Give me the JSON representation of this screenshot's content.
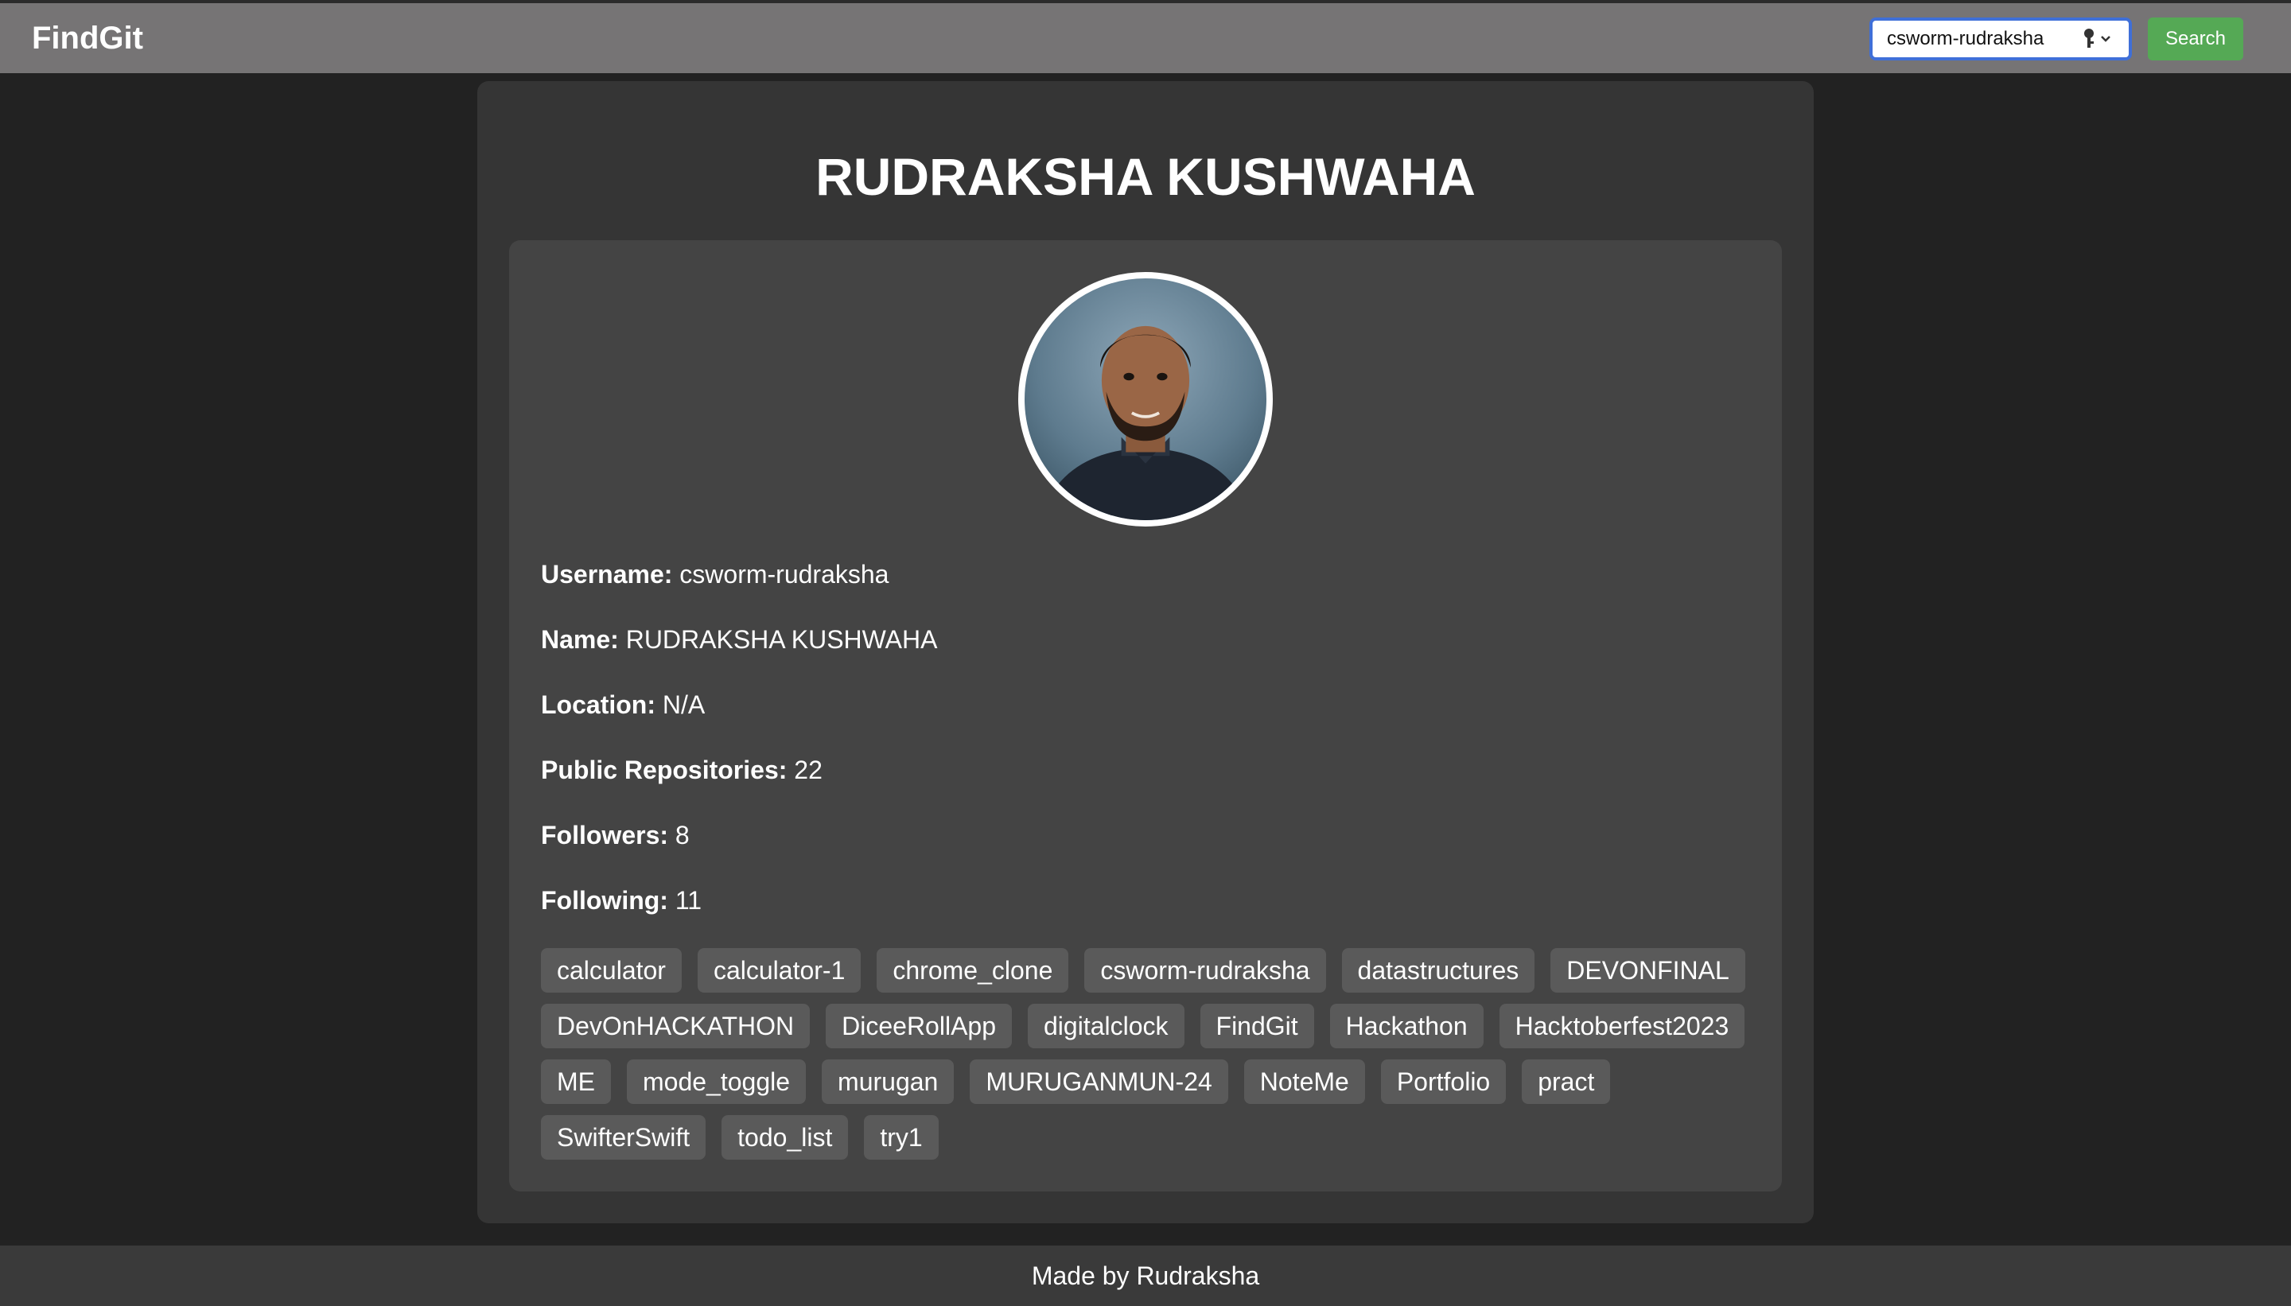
{
  "app": {
    "brand": "FindGit"
  },
  "search": {
    "value": "csworm-rudraksha",
    "button_label": "Search"
  },
  "profile": {
    "title": "RUDRAKSHA KUSHWAHA",
    "fields": [
      {
        "label": "Username:",
        "value": "csworm-rudraksha"
      },
      {
        "label": "Name:",
        "value": "RUDRAKSHA KUSHWAHA"
      },
      {
        "label": "Location:",
        "value": "N/A"
      },
      {
        "label": "Public Repositories:",
        "value": "22"
      },
      {
        "label": "Followers:",
        "value": "8"
      },
      {
        "label": "Following:",
        "value": "11"
      }
    ],
    "repositories": [
      "calculator",
      "calculator-1",
      "chrome_clone",
      "csworm-rudraksha",
      "datastructures",
      "DEVONFINAL",
      "DevOnHACKATHON",
      "DiceeRollApp",
      "digitalclock",
      "FindGit",
      "Hackathon",
      "Hacktoberfest2023",
      "ME",
      "mode_toggle",
      "murugan",
      "MURUGANMUN-24",
      "NoteMe",
      "Portfolio",
      "pract",
      "SwifterSwift",
      "todo_list",
      "try1"
    ]
  },
  "footer": {
    "text": "Made by Rudraksha"
  },
  "colors": {
    "page_bg": "#222222",
    "navbar_bg": "#767475",
    "card_bg": "#353535",
    "inner_card_bg": "#444444",
    "tag_bg": "#5a5a5a",
    "search_button": "#55a955",
    "search_focus": "#3f6fd8"
  },
  "icons": {
    "password_manager": "key-icon"
  }
}
